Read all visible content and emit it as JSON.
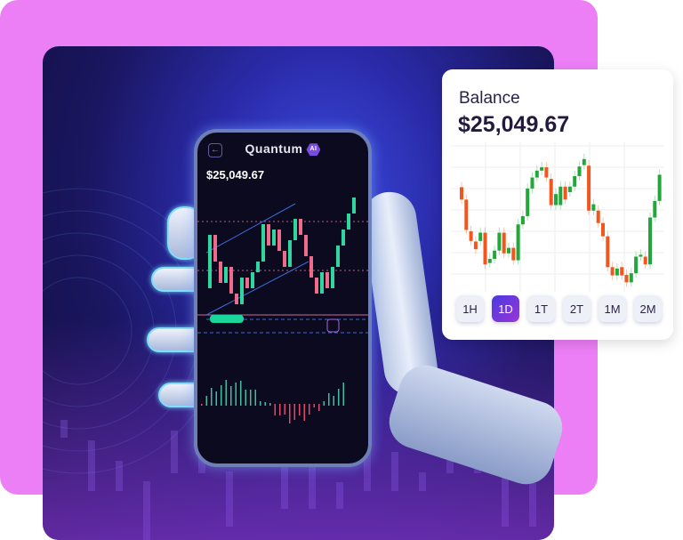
{
  "phone": {
    "app_title": "Quantum",
    "ai_badge": "AI",
    "balance": "$25,049.67",
    "back_icon": "arrow-left-icon",
    "candles": [
      [
        20,
        40
      ],
      [
        40,
        30
      ],
      [
        30,
        22
      ],
      [
        22,
        28
      ],
      [
        28,
        18
      ],
      [
        18,
        14
      ],
      [
        14,
        24
      ],
      [
        24,
        20
      ],
      [
        20,
        26
      ],
      [
        26,
        30
      ],
      [
        30,
        44
      ],
      [
        44,
        36
      ],
      [
        36,
        42
      ],
      [
        42,
        34
      ],
      [
        34,
        28
      ],
      [
        28,
        38
      ],
      [
        38,
        46
      ],
      [
        46,
        40
      ],
      [
        40,
        32
      ],
      [
        32,
        24
      ],
      [
        24,
        18
      ],
      [
        18,
        26
      ],
      [
        26,
        20
      ],
      [
        20,
        28
      ],
      [
        28,
        36
      ],
      [
        36,
        42
      ],
      [
        42,
        48
      ],
      [
        48,
        54
      ]
    ]
  },
  "card": {
    "title": "Balance",
    "value": "$25,049.67",
    "colors": {
      "up": "#22a83a",
      "down": "#f2561d",
      "active": "#6a38dc"
    },
    "timeframes": [
      "1H",
      "1D",
      "1T",
      "2T",
      "1M",
      "2M"
    ],
    "active_timeframe": "1D",
    "candles": [
      [
        36,
        31.5
      ],
      [
        31.5,
        20.5
      ],
      [
        20,
        16.5
      ],
      [
        16.3,
        13.5
      ],
      [
        16.5,
        19.5
      ],
      [
        19.5,
        8
      ],
      [
        8.5,
        10
      ],
      [
        10,
        13
      ],
      [
        13,
        19.5
      ],
      [
        19.5,
        12
      ],
      [
        12,
        14
      ],
      [
        14,
        9.5
      ],
      [
        9.5,
        22.5
      ],
      [
        22.5,
        25.5
      ],
      [
        25.5,
        35.5
      ],
      [
        35.5,
        39.5
      ],
      [
        39.5,
        42
      ],
      [
        42,
        43.2
      ],
      [
        43.2,
        39.5
      ],
      [
        39,
        29.5
      ],
      [
        29.5,
        33.5
      ],
      [
        29.5,
        36.2
      ],
      [
        36.2,
        31.5
      ],
      [
        34.2,
        36.2
      ],
      [
        36.2,
        40
      ],
      [
        40,
        43.5
      ],
      [
        44,
        46.2
      ],
      [
        43.8,
        27.5
      ],
      [
        27.5,
        29.8
      ],
      [
        27.5,
        23
      ],
      [
        23,
        18.2
      ],
      [
        18.2,
        7
      ],
      [
        7,
        4
      ],
      [
        4,
        6.5
      ],
      [
        7,
        4
      ],
      [
        4.2,
        1.5
      ],
      [
        1.5,
        4.8
      ],
      [
        4.8,
        10.8
      ],
      [
        10.8,
        11.5
      ],
      [
        10.8,
        8
      ],
      [
        8,
        25
      ],
      [
        25,
        31
      ],
      [
        31,
        40.5
      ]
    ]
  }
}
